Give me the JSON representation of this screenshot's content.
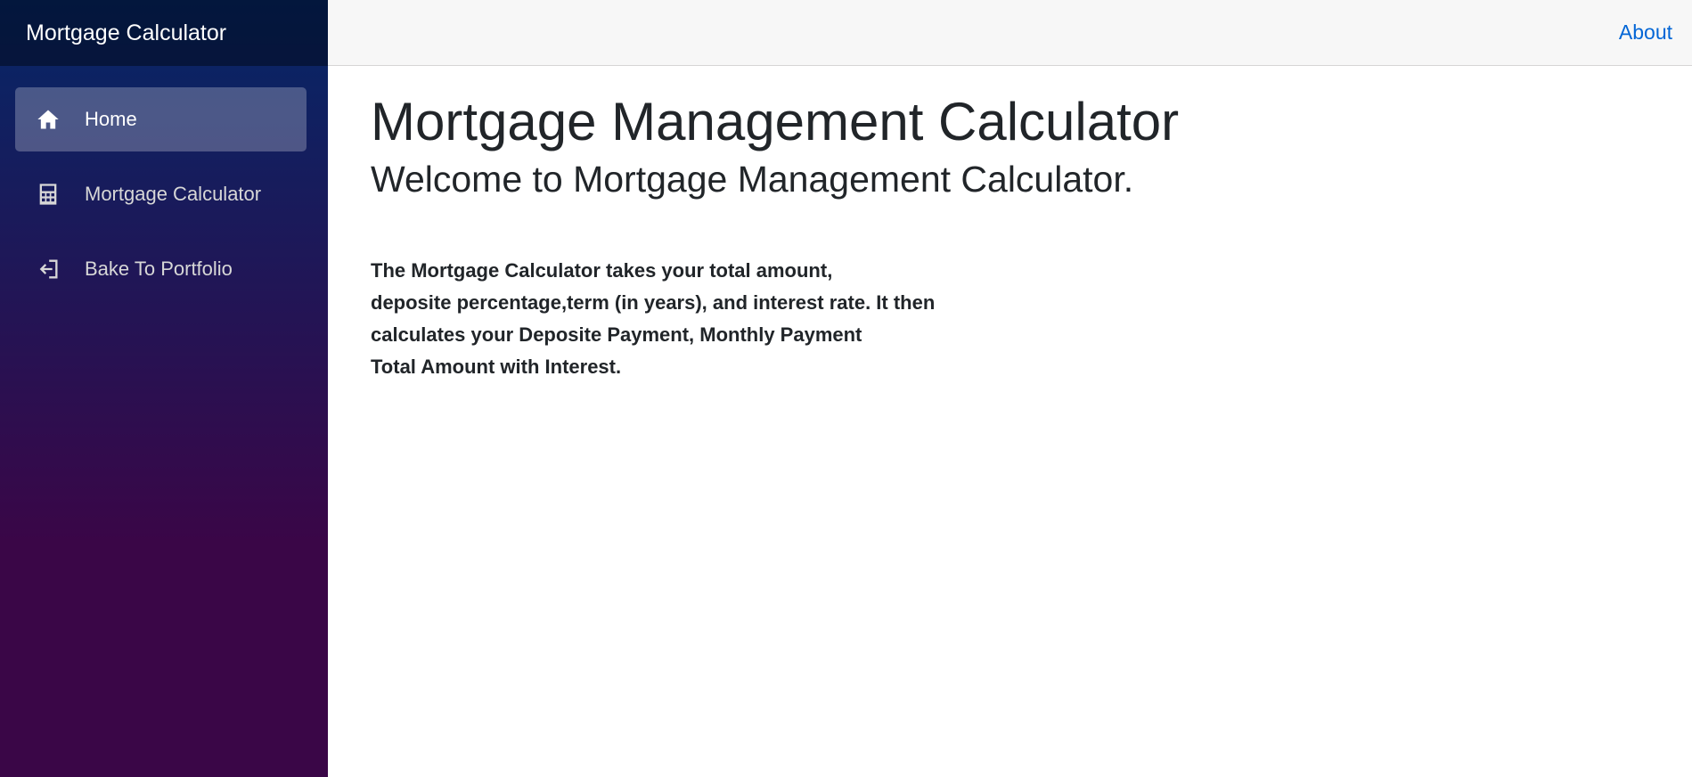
{
  "sidebar": {
    "brand": "Mortgage Calculator",
    "items": [
      {
        "label": "Home",
        "icon": "home-icon",
        "active": true
      },
      {
        "label": "Mortgage Calculator",
        "icon": "calculator-icon",
        "active": false
      },
      {
        "label": "Bake To Portfolio",
        "icon": "exit-icon",
        "active": false
      }
    ]
  },
  "header": {
    "about_label": "About"
  },
  "main": {
    "title": "Mortgage Management Calculator",
    "welcome": "Welcome to Mortgage Management Calculator.",
    "description_lines": [
      "The Mortgage Calculator takes your total amount,",
      "deposite percentage,term (in years), and interest rate. It then",
      "calculates your Deposite Payment, Monthly Payment",
      "Total Amount with Interest."
    ]
  },
  "colors": {
    "sidebar_top": "#052767",
    "sidebar_bottom": "#3a0647",
    "link": "#0366d6",
    "header_bg": "#f7f7f7"
  }
}
